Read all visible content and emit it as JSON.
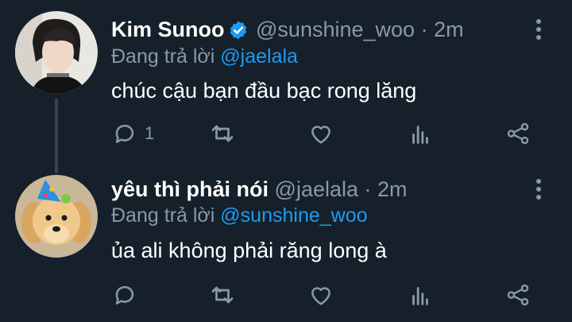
{
  "tweets": [
    {
      "name": "Kim Sunoo",
      "handle": "@sunshine_woo",
      "separator": "·",
      "time": "2m",
      "replying_prefix": "Đang trả lời",
      "replying_to": "@jaelala",
      "text": "chúc cậu bạn đầu bạc rong lăng",
      "reply_count": "1",
      "verified": true
    },
    {
      "name": "yêu thì phải nói",
      "handle": "@jaelala",
      "separator": "·",
      "time": "2m",
      "replying_prefix": "Đang trả lời",
      "replying_to": "@sunshine_woo",
      "text": "ủa ali không phải răng long à",
      "reply_count": "",
      "verified": false
    }
  ],
  "colors": {
    "background": "#15202b",
    "secondary_text": "#8b98a5",
    "accent": "#1d9bf0",
    "thread_line": "#38444d"
  },
  "icons": [
    "verified-badge-icon",
    "reply-icon",
    "retweet-icon",
    "like-icon",
    "analytics-icon",
    "share-icon",
    "more-options-icon"
  ]
}
